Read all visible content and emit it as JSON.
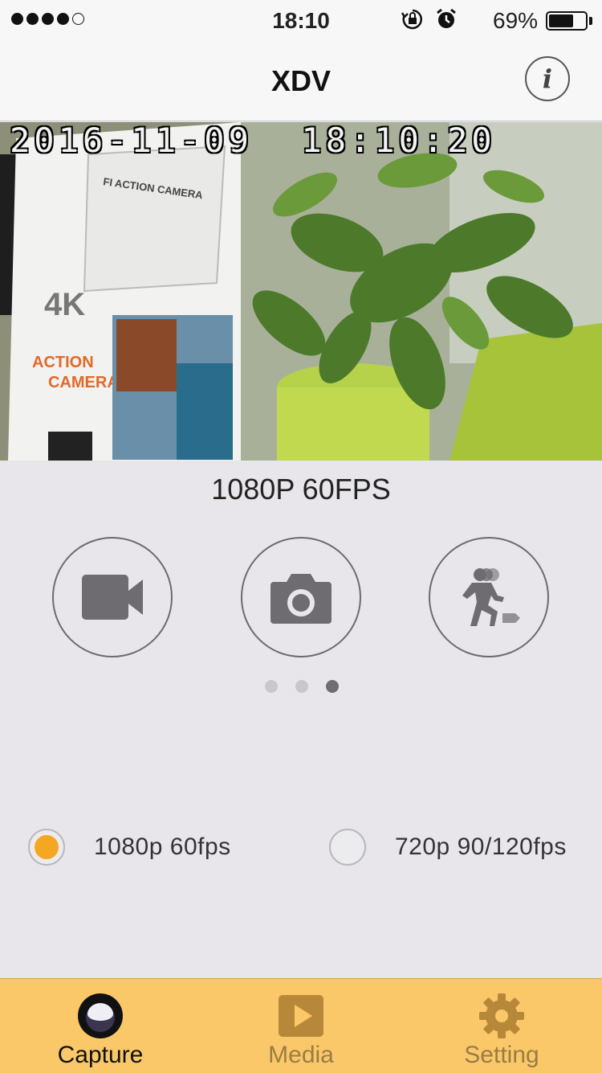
{
  "status_bar": {
    "time": "18:10",
    "battery_percent": "69%",
    "battery_level": 0.69,
    "signal_bars_filled": 4,
    "signal_bars_total": 5,
    "icons": [
      "rotation-lock-icon",
      "alarm-icon"
    ]
  },
  "nav": {
    "title": "XDV",
    "info_icon": "i"
  },
  "preview": {
    "timestamp": "2016-11-09  18:10:20"
  },
  "capture": {
    "resolution_label": "1080P 60FPS",
    "modes": [
      {
        "name": "video",
        "icon": "video-camera-icon"
      },
      {
        "name": "photo",
        "icon": "camera-icon"
      },
      {
        "name": "burst",
        "icon": "burst-runner-icon"
      }
    ],
    "page_count": 3,
    "active_page": 3
  },
  "options": [
    {
      "label": "1080p 60fps",
      "selected": true
    },
    {
      "label": "720p 90/120fps",
      "selected": false
    }
  ],
  "tabs": [
    {
      "label": "Capture",
      "icon": "capture-lens-icon",
      "active": true
    },
    {
      "label": "Media",
      "icon": "play-icon",
      "active": false
    },
    {
      "label": "Setting",
      "icon": "gear-icon",
      "active": false
    }
  ],
  "colors": {
    "accent": "#f5a623",
    "tab_bar": "#fac868",
    "background": "#e8e6ea"
  }
}
